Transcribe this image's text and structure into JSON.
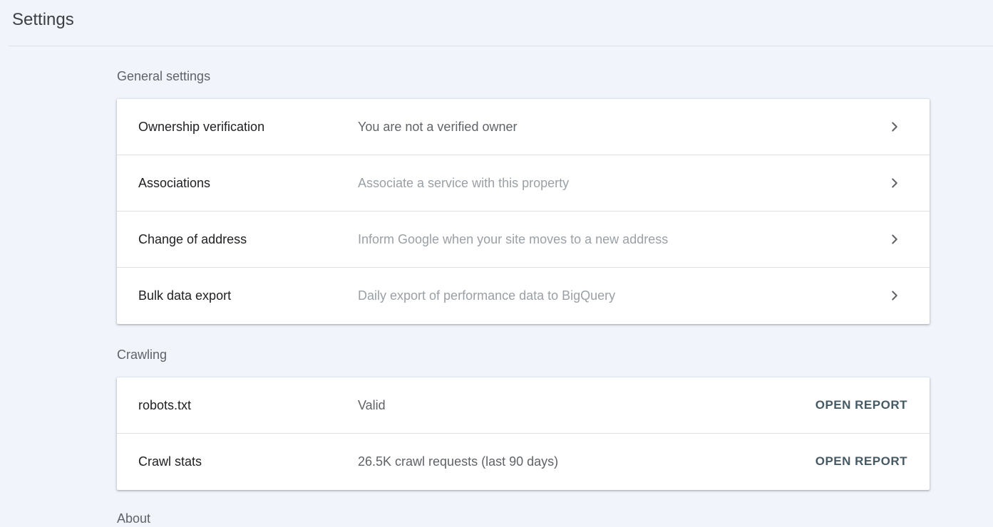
{
  "header": {
    "title": "Settings"
  },
  "general": {
    "heading": "General settings",
    "items": [
      {
        "label": "Ownership verification",
        "description": "You are not a verified owner"
      },
      {
        "label": "Associations",
        "description": "Associate a service with this property"
      },
      {
        "label": "Change of address",
        "description": "Inform Google when your site moves to a new address"
      },
      {
        "label": "Bulk data export",
        "description": "Daily export of performance data to BigQuery"
      }
    ]
  },
  "crawling": {
    "heading": "Crawling",
    "items": [
      {
        "label": "robots.txt",
        "description": "Valid",
        "action": "OPEN REPORT"
      },
      {
        "label": "Crawl stats",
        "description": "26.5K crawl requests (last 90 days)",
        "action": "OPEN REPORT"
      }
    ]
  },
  "about": {
    "heading": "About"
  },
  "icons": {
    "chevron": "chevron-right-icon"
  }
}
